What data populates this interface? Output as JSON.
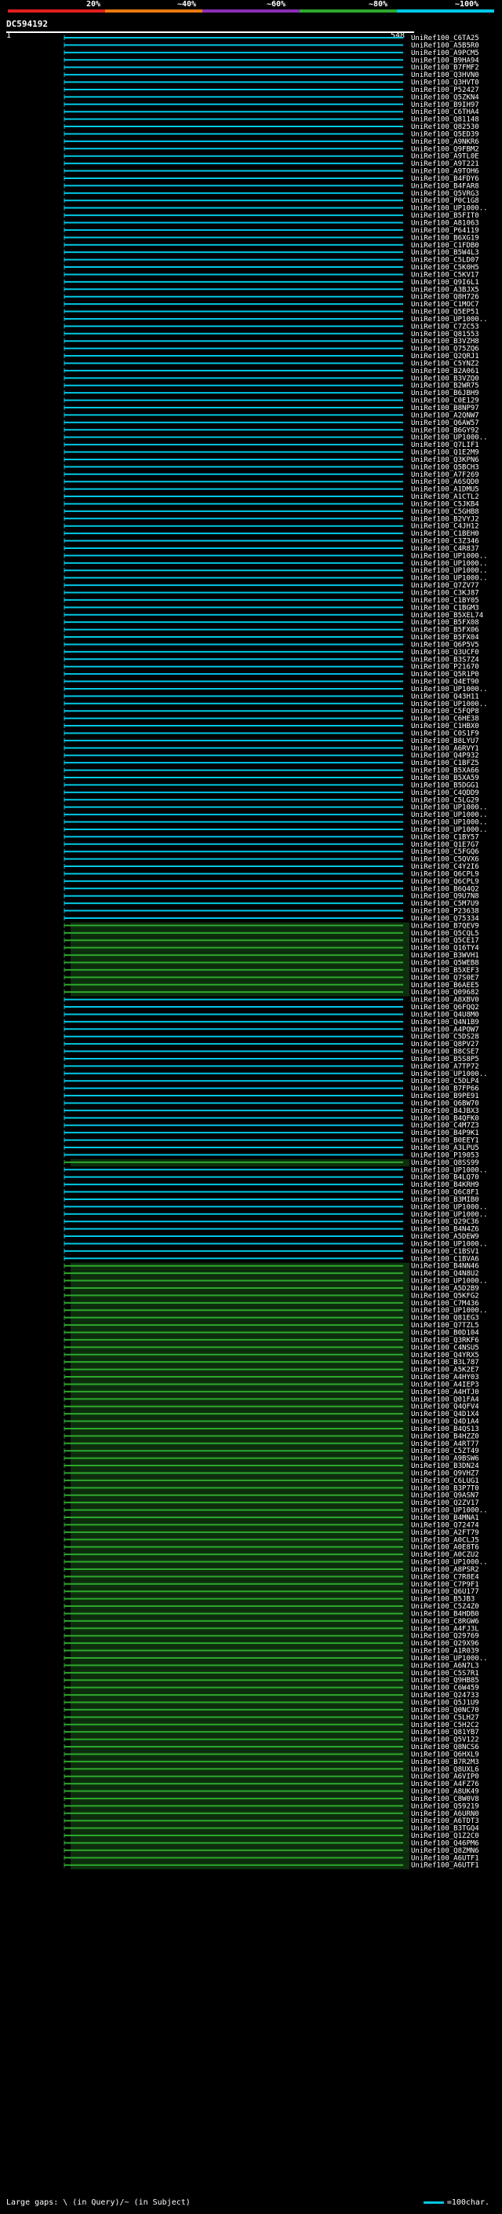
{
  "query": {
    "id": "DC594192",
    "axis_start": "1",
    "axis_end": "548"
  },
  "scale_labels": [
    "20%",
    "~40%",
    "~60%",
    "~80%",
    "~100%"
  ],
  "scale_colors": [
    "#e0201e",
    "#e87a10",
    "#8a2fb5",
    "#2ea82e",
    "#00c8e6"
  ],
  "footer": {
    "text": "Large gaps: \\ (in Query)/~ (in Subject)",
    "legend": "=100char."
  },
  "hits": [
    {
      "label": "UniRef100_C6TA25",
      "c": "cyan"
    },
    {
      "label": "UniRef100_A5B5R0",
      "c": "cyan"
    },
    {
      "label": "UniRef100_A9PCM5",
      "c": "cyan"
    },
    {
      "label": "UniRef100_B9HA94",
      "c": "cyan"
    },
    {
      "label": "UniRef100_B7FMF2",
      "c": "cyan"
    },
    {
      "label": "UniRef100_Q3HVN0",
      "c": "cyan"
    },
    {
      "label": "UniRef100_Q3HVT0",
      "c": "cyan"
    },
    {
      "label": "UniRef100_P52427",
      "c": "cyan"
    },
    {
      "label": "UniRef100_Q5ZKN4",
      "c": "cyan"
    },
    {
      "label": "UniRef100_B9IH97",
      "c": "cyan"
    },
    {
      "label": "UniRef100_C6THA4",
      "c": "cyan"
    },
    {
      "label": "UniRef100_Q81148",
      "c": "cyan"
    },
    {
      "label": "UniRef100_Q82530",
      "c": "cyan"
    },
    {
      "label": "UniRef100_Q5ED39",
      "c": "cyan"
    },
    {
      "label": "UniRef100_A9NKR6",
      "c": "cyan"
    },
    {
      "label": "UniRef100_Q9FBM2",
      "c": "cyan"
    },
    {
      "label": "UniRef100_A9TL0E",
      "c": "cyan"
    },
    {
      "label": "UniRef100_A9T221",
      "c": "cyan"
    },
    {
      "label": "UniRef100_A9TOH6",
      "c": "cyan"
    },
    {
      "label": "UniRef100_B4FDY6",
      "c": "cyan"
    },
    {
      "label": "UniRef100_B4FAR8",
      "c": "cyan"
    },
    {
      "label": "UniRef100_Q5VRG3",
      "c": "cyan"
    },
    {
      "label": "UniRef100_P0C1G8",
      "c": "cyan"
    },
    {
      "label": "UniRef100_UP1000..",
      "c": "cyan"
    },
    {
      "label": "UniRef100_B5FIT0",
      "c": "cyan"
    },
    {
      "label": "UniRef100_A81063",
      "c": "cyan"
    },
    {
      "label": "UniRef100_P64119",
      "c": "cyan"
    },
    {
      "label": "UniRef100_B6XG19",
      "c": "cyan"
    },
    {
      "label": "UniRef100_C1FDB0",
      "c": "cyan"
    },
    {
      "label": "UniRef100_B5W4L3",
      "c": "cyan"
    },
    {
      "label": "UniRef100_C5LD07",
      "c": "cyan"
    },
    {
      "label": "UniRef100_C5K0H5",
      "c": "cyan"
    },
    {
      "label": "UniRef100_C5KV17",
      "c": "cyan"
    },
    {
      "label": "UniRef100_Q9I6L1",
      "c": "cyan"
    },
    {
      "label": "UniRef100_A3BJX5",
      "c": "cyan"
    },
    {
      "label": "UniRef100_Q8H726",
      "c": "cyan"
    },
    {
      "label": "UniRef100_C1MOC7",
      "c": "cyan"
    },
    {
      "label": "UniRef100_Q5EP51",
      "c": "cyan"
    },
    {
      "label": "UniRef100_UP1000..",
      "c": "cyan"
    },
    {
      "label": "UniRef100_C7ZC53",
      "c": "cyan"
    },
    {
      "label": "UniRef100_Q81553",
      "c": "cyan"
    },
    {
      "label": "UniRef100_B3VZH8",
      "c": "cyan"
    },
    {
      "label": "UniRef100_Q75ZQ6",
      "c": "cyan"
    },
    {
      "label": "UniRef100_Q2QRJ1",
      "c": "cyan"
    },
    {
      "label": "UniRef100_C5YNZ2",
      "c": "cyan"
    },
    {
      "label": "UniRef100_B2A061",
      "c": "cyan"
    },
    {
      "label": "UniRef100_B3VZQ0",
      "c": "cyan"
    },
    {
      "label": "UniRef100_B2WR75",
      "c": "cyan"
    },
    {
      "label": "UniRef100_B6JBH9",
      "c": "cyan"
    },
    {
      "label": "UniRef100_C0E129",
      "c": "cyan"
    },
    {
      "label": "UniRef100_B8NP97",
      "c": "cyan"
    },
    {
      "label": "UniRef100_A2QNW7",
      "c": "cyan"
    },
    {
      "label": "UniRef100_Q6AW57",
      "c": "cyan"
    },
    {
      "label": "UniRef100_B6GY92",
      "c": "cyan"
    },
    {
      "label": "UniRef100_UP1000..",
      "c": "cyan"
    },
    {
      "label": "UniRef100_Q7LIF1",
      "c": "cyan"
    },
    {
      "label": "UniRef100_Q1E2M9",
      "c": "cyan"
    },
    {
      "label": "UniRef100_Q3KPN6",
      "c": "cyan"
    },
    {
      "label": "UniRef100_Q5BCH3",
      "c": "cyan"
    },
    {
      "label": "UniRef100_A7F269",
      "c": "cyan"
    },
    {
      "label": "UniRef100_A6SQD0",
      "c": "cyan"
    },
    {
      "label": "UniRef100_A1DMU5",
      "c": "cyan"
    },
    {
      "label": "UniRef100_A1CTL2",
      "c": "cyan"
    },
    {
      "label": "UniRef100_C5JKB4",
      "c": "cyan"
    },
    {
      "label": "UniRef100_C5GHB8",
      "c": "cyan"
    },
    {
      "label": "UniRef100_B2VYJ2",
      "c": "cyan"
    },
    {
      "label": "UniRef100_C4JH12",
      "c": "cyan"
    },
    {
      "label": "UniRef100_C1BEH0",
      "c": "cyan"
    },
    {
      "label": "UniRef100_C3Z346",
      "c": "cyan"
    },
    {
      "label": "UniRef100_C4R837",
      "c": "cyan"
    },
    {
      "label": "UniRef100_UP1000..",
      "c": "cyan"
    },
    {
      "label": "UniRef100_UP1000..",
      "c": "cyan"
    },
    {
      "label": "UniRef100_UP1000..",
      "c": "cyan"
    },
    {
      "label": "UniRef100_UP1000..",
      "c": "cyan"
    },
    {
      "label": "UniRef100_Q7ZV77",
      "c": "cyan"
    },
    {
      "label": "UniRef100_C3KJ87",
      "c": "cyan"
    },
    {
      "label": "UniRef100_C1BY05",
      "c": "cyan"
    },
    {
      "label": "UniRef100_C1BGM3",
      "c": "cyan"
    },
    {
      "label": "UniRef100_B5XEL74",
      "c": "cyan"
    },
    {
      "label": "UniRef100_B5FX08",
      "c": "cyan"
    },
    {
      "label": "UniRef100_B5FX06",
      "c": "cyan"
    },
    {
      "label": "UniRef100_B5FX04",
      "c": "cyan"
    },
    {
      "label": "UniRef100_Q6P5V5",
      "c": "cyan"
    },
    {
      "label": "UniRef100_Q3UCF0",
      "c": "cyan"
    },
    {
      "label": "UniRef100_B3S7Z4",
      "c": "cyan"
    },
    {
      "label": "UniRef100_P21670",
      "c": "cyan"
    },
    {
      "label": "UniRef100_Q5R1P0",
      "c": "cyan"
    },
    {
      "label": "UniRef100_Q4ET90",
      "c": "cyan"
    },
    {
      "label": "UniRef100_UP1000..",
      "c": "cyan"
    },
    {
      "label": "UniRef100_Q43H11",
      "c": "cyan"
    },
    {
      "label": "UniRef100_UP1000..",
      "c": "cyan"
    },
    {
      "label": "UniRef100_C5FQP8",
      "c": "cyan"
    },
    {
      "label": "UniRef100_C6HE38",
      "c": "cyan"
    },
    {
      "label": "UniRef100_C1HBX0",
      "c": "cyan"
    },
    {
      "label": "UniRef100_C0S1F9",
      "c": "cyan"
    },
    {
      "label": "UniRef100_B8LYU7",
      "c": "cyan"
    },
    {
      "label": "UniRef100_A6RVY1",
      "c": "cyan"
    },
    {
      "label": "UniRef100_Q4P932",
      "c": "cyan"
    },
    {
      "label": "UniRef100_C1BFZ5",
      "c": "cyan"
    },
    {
      "label": "UniRef100_B5XA66",
      "c": "cyan"
    },
    {
      "label": "UniRef100_B5XA59",
      "c": "cyan"
    },
    {
      "label": "UniRef100_B5DGG1",
      "c": "cyan"
    },
    {
      "label": "UniRef100_C4QDD9",
      "c": "cyan"
    },
    {
      "label": "UniRef100_C5LG29",
      "c": "cyan"
    },
    {
      "label": "UniRef100_UP1000..",
      "c": "cyan"
    },
    {
      "label": "UniRef100_UP1000..",
      "c": "cyan"
    },
    {
      "label": "UniRef100_UP1000..",
      "c": "cyan"
    },
    {
      "label": "UniRef100_UP1000..",
      "c": "cyan"
    },
    {
      "label": "UniRef100_C1BY57",
      "c": "cyan"
    },
    {
      "label": "UniRef100_Q1E7G7",
      "c": "cyan"
    },
    {
      "label": "UniRef100_C5FGQ6",
      "c": "cyan"
    },
    {
      "label": "UniRef100_C5QVX6",
      "c": "cyan"
    },
    {
      "label": "UniRef100_C4Y2I6",
      "c": "cyan"
    },
    {
      "label": "UniRef100_Q6CPL9",
      "c": "cyan"
    },
    {
      "label": "UniRef100_Q6CPL9",
      "c": "cyan"
    },
    {
      "label": "UniRef100_B6Q4Q2",
      "c": "cyan"
    },
    {
      "label": "UniRef100_Q9U7N8",
      "c": "cyan"
    },
    {
      "label": "UniRef100_C5M7U9",
      "c": "cyan"
    },
    {
      "label": "UniRef100_P23638",
      "c": "cyan"
    },
    {
      "label": "UniRef100_Q75334",
      "c": "cyan"
    },
    {
      "label": "UniRef100_B7QEV9",
      "c": "green"
    },
    {
      "label": "UniRef100_Q5CQL5",
      "c": "green"
    },
    {
      "label": "UniRef100_Q5CE17",
      "c": "green"
    },
    {
      "label": "UniRef100_Q16TY4",
      "c": "green"
    },
    {
      "label": "UniRef100_B3WVH1",
      "c": "green"
    },
    {
      "label": "UniRef100_Q5WEB8",
      "c": "green"
    },
    {
      "label": "UniRef100_B5XEF3",
      "c": "green"
    },
    {
      "label": "UniRef100_Q7S0E7",
      "c": "green"
    },
    {
      "label": "UniRef100_B6AEE5",
      "c": "green"
    },
    {
      "label": "UniRef100_Q09682",
      "c": "green"
    },
    {
      "label": "UniRef100_A8XBV0",
      "c": "cyan"
    },
    {
      "label": "UniRef100_Q6FQQ2",
      "c": "cyan"
    },
    {
      "label": "UniRef100_Q4U8M0",
      "c": "cyan"
    },
    {
      "label": "UniRef100_Q4N1B9",
      "c": "cyan"
    },
    {
      "label": "UniRef100_A4POW7",
      "c": "cyan"
    },
    {
      "label": "UniRef100_C5DS28",
      "c": "cyan"
    },
    {
      "label": "UniRef100_Q8PV27",
      "c": "cyan"
    },
    {
      "label": "UniRef100_B8CSE7",
      "c": "cyan"
    },
    {
      "label": "UniRef100_B5S8P5",
      "c": "cyan"
    },
    {
      "label": "UniRef100_A7TP72",
      "c": "cyan"
    },
    {
      "label": "UniRef100_UP1000..",
      "c": "cyan"
    },
    {
      "label": "UniRef100_C5DLP4",
      "c": "cyan"
    },
    {
      "label": "UniRef100_B7FP66",
      "c": "cyan"
    },
    {
      "label": "UniRef100_B9PE91",
      "c": "cyan"
    },
    {
      "label": "UniRef100_Q6BW70",
      "c": "cyan"
    },
    {
      "label": "UniRef100_B4JBX3",
      "c": "cyan"
    },
    {
      "label": "UniRef100_B4QFK0",
      "c": "cyan"
    },
    {
      "label": "UniRef100_C4M7Z3",
      "c": "cyan"
    },
    {
      "label": "UniRef100_B4P9K1",
      "c": "cyan"
    },
    {
      "label": "UniRef100_B0EEY1",
      "c": "cyan"
    },
    {
      "label": "UniRef100_A3LPU5",
      "c": "cyan"
    },
    {
      "label": "UniRef100_P19053",
      "c": "cyan"
    },
    {
      "label": "UniRef100_Q8SS99",
      "c": "green"
    },
    {
      "label": "UniRef100_UP1000..",
      "c": "cyan"
    },
    {
      "label": "UniRef100_B4LQ70",
      "c": "cyan"
    },
    {
      "label": "UniRef100_B4KRH9",
      "c": "cyan"
    },
    {
      "label": "UniRef100_Q6C8F1",
      "c": "cyan"
    },
    {
      "label": "UniRef100_B3MIB0",
      "c": "cyan"
    },
    {
      "label": "UniRef100_UP1000..",
      "c": "cyan"
    },
    {
      "label": "UniRef100_UP1000..",
      "c": "cyan"
    },
    {
      "label": "UniRef100_Q29C36",
      "c": "cyan"
    },
    {
      "label": "UniRef100_B4N4Z6",
      "c": "cyan"
    },
    {
      "label": "UniRef100_A5DEW9",
      "c": "cyan"
    },
    {
      "label": "UniRef100_UP1000..",
      "c": "cyan"
    },
    {
      "label": "UniRef100_C1BSV1",
      "c": "cyan"
    },
    {
      "label": "UniRef100_C1BVA6",
      "c": "cyan"
    },
    {
      "label": "UniRef100_B4NN46",
      "c": "green"
    },
    {
      "label": "UniRef100_Q4N8U2",
      "c": "green"
    },
    {
      "label": "UniRef100_UP1000..",
      "c": "green"
    },
    {
      "label": "UniRef100_A5D2B9",
      "c": "green"
    },
    {
      "label": "UniRef100_Q5KFG2",
      "c": "green"
    },
    {
      "label": "UniRef100_C7M436",
      "c": "green"
    },
    {
      "label": "UniRef100_UP1000..",
      "c": "green"
    },
    {
      "label": "UniRef100_Q81EG3",
      "c": "green"
    },
    {
      "label": "UniRef100_Q7TZL5",
      "c": "green"
    },
    {
      "label": "UniRef100_B0D104",
      "c": "green"
    },
    {
      "label": "UniRef100_Q3RKF6",
      "c": "green"
    },
    {
      "label": "UniRef100_C4NSU5",
      "c": "green"
    },
    {
      "label": "UniRef100_Q4YRX5",
      "c": "green"
    },
    {
      "label": "UniRef100_B3L787",
      "c": "green"
    },
    {
      "label": "UniRef100_A5K2E7",
      "c": "green"
    },
    {
      "label": "UniRef100_A4HY03",
      "c": "green"
    },
    {
      "label": "UniRef100_A4IEP3",
      "c": "green"
    },
    {
      "label": "UniRef100_A4HTJ0",
      "c": "green"
    },
    {
      "label": "UniRef100_Q01FA4",
      "c": "green"
    },
    {
      "label": "UniRef100_Q4QFV4",
      "c": "green"
    },
    {
      "label": "UniRef100_Q4D1X4",
      "c": "green"
    },
    {
      "label": "UniRef100_Q4D1A4",
      "c": "green"
    },
    {
      "label": "UniRef100_B4QS13",
      "c": "green"
    },
    {
      "label": "UniRef100_B4HZZ0",
      "c": "green"
    },
    {
      "label": "UniRef100_A4RT77",
      "c": "green"
    },
    {
      "label": "UniRef100_C5ZT49",
      "c": "green"
    },
    {
      "label": "UniRef100_A9BSW6",
      "c": "green"
    },
    {
      "label": "UniRef100_B3DN24",
      "c": "green"
    },
    {
      "label": "UniRef100_Q9VHZ7",
      "c": "green"
    },
    {
      "label": "UniRef100_C6LUG1",
      "c": "green"
    },
    {
      "label": "UniRef100_B3P7T0",
      "c": "green"
    },
    {
      "label": "UniRef100_Q9ASN7",
      "c": "green"
    },
    {
      "label": "UniRef100_Q2ZV17",
      "c": "green"
    },
    {
      "label": "UniRef100_UP1000..",
      "c": "green"
    },
    {
      "label": "UniRef100_B4MNA1",
      "c": "green"
    },
    {
      "label": "UniRef100_Q72474",
      "c": "green"
    },
    {
      "label": "UniRef100_A2FT79",
      "c": "green"
    },
    {
      "label": "UniRef100_A0CLJ5",
      "c": "green"
    },
    {
      "label": "UniRef100_A0E8T6",
      "c": "green"
    },
    {
      "label": "UniRef100_A0CZU2",
      "c": "green"
    },
    {
      "label": "UniRef100_UP1000..",
      "c": "green"
    },
    {
      "label": "UniRef100_A8PSR2",
      "c": "green"
    },
    {
      "label": "UniRef100_C7R8E4",
      "c": "green"
    },
    {
      "label": "UniRef100_C7P9F1",
      "c": "green"
    },
    {
      "label": "UniRef100_Q6U177",
      "c": "green"
    },
    {
      "label": "UniRef100_B5JB3",
      "c": "green"
    },
    {
      "label": "UniRef100_C5Z4Z0",
      "c": "green"
    },
    {
      "label": "UniRef100_B4HDB0",
      "c": "green"
    },
    {
      "label": "UniRef100_C8RGW6",
      "c": "green"
    },
    {
      "label": "UniRef100_A4FJ3L",
      "c": "green"
    },
    {
      "label": "UniRef100_Q29769",
      "c": "green"
    },
    {
      "label": "UniRef100_Q29X96",
      "c": "green"
    },
    {
      "label": "UniRef100_A1R039",
      "c": "green"
    },
    {
      "label": "UniRef100_UP1000..",
      "c": "green"
    },
    {
      "label": "UniRef100_A6N7L3",
      "c": "green"
    },
    {
      "label": "UniRef100_C5S7R1",
      "c": "green"
    },
    {
      "label": "UniRef100_Q9HB85",
      "c": "green"
    },
    {
      "label": "UniRef100_C6W459",
      "c": "green"
    },
    {
      "label": "UniRef100_Q24733",
      "c": "green"
    },
    {
      "label": "UniRef100_Q5J1U9",
      "c": "green"
    },
    {
      "label": "UniRef100_Q0NC70",
      "c": "green"
    },
    {
      "label": "UniRef100_C5LH27",
      "c": "green"
    },
    {
      "label": "UniRef100_C5H2C2",
      "c": "green"
    },
    {
      "label": "UniRef100_Q81YB7",
      "c": "green"
    },
    {
      "label": "UniRef100_Q5V122",
      "c": "green"
    },
    {
      "label": "UniRef100_Q8NCS6",
      "c": "green"
    },
    {
      "label": "UniRef100_Q6HXL9",
      "c": "green"
    },
    {
      "label": "UniRef100_B7R2M3",
      "c": "green"
    },
    {
      "label": "UniRef100_Q8UXL6",
      "c": "green"
    },
    {
      "label": "UniRef100_A6VIP0",
      "c": "green"
    },
    {
      "label": "UniRef100_A4FZ76",
      "c": "green"
    },
    {
      "label": "UniRef100_A8UK49",
      "c": "green"
    },
    {
      "label": "UniRef100_C8W0V8",
      "c": "green"
    },
    {
      "label": "UniRef100_Q59219",
      "c": "green"
    },
    {
      "label": "UniRef100_A6URN0",
      "c": "green"
    },
    {
      "label": "UniRef100_A6TDT3",
      "c": "green"
    },
    {
      "label": "UniRef100_B3TGQ4",
      "c": "green"
    },
    {
      "label": "UniRef100_Q1Z2C0",
      "c": "green"
    },
    {
      "label": "UniRef100_Q46PM6",
      "c": "green"
    },
    {
      "label": "UniRef100_Q8ZMN6",
      "c": "green"
    },
    {
      "label": "UniRef100_A6UTF1",
      "c": "green"
    },
    {
      "label": "UniRef100_A6UTF1",
      "c": "green"
    }
  ]
}
